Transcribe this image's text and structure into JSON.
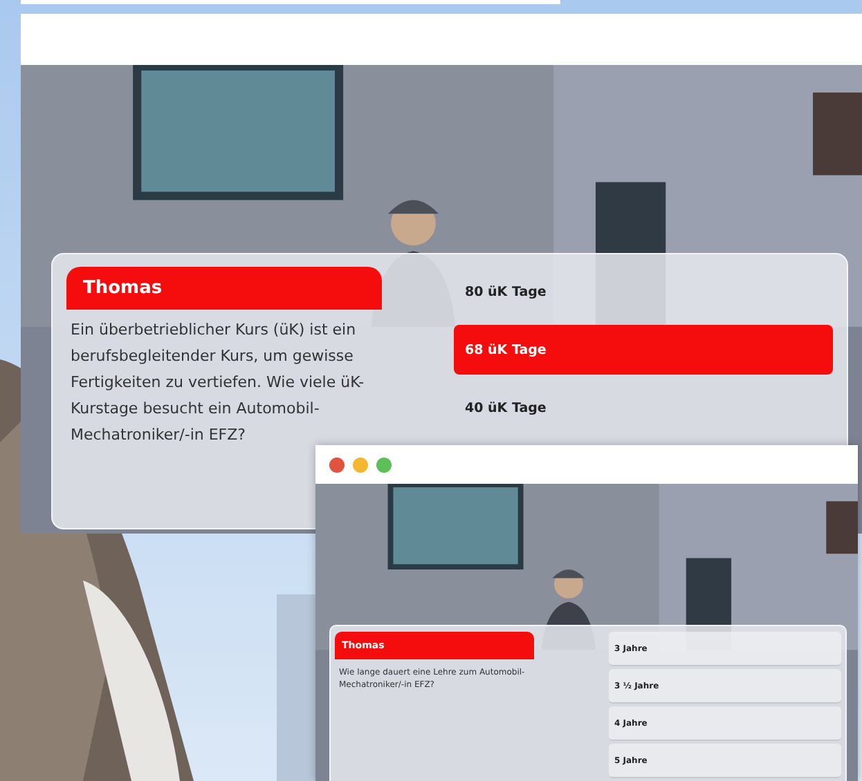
{
  "windows": [
    {
      "kind": "large",
      "dialog": {
        "speaker": "Thomas",
        "question": "Ein überbetrieblicher Kurs (üK) ist ein berufsbegleitender Kurs, um gewisse Fertigkeiten zu vertiefen. Wie viele üK-Kurstage besucht ein Automobil-Mechatroniker/-in EFZ?",
        "answers": [
          {
            "label": "80 üK Tage",
            "selected": false
          },
          {
            "label": "68 üK Tage",
            "selected": true
          },
          {
            "label": "40 üK Tage",
            "selected": false
          }
        ]
      }
    },
    {
      "kind": "small",
      "window_buttons": true,
      "dialog": {
        "speaker": "Thomas",
        "question": "Wie lange dauert eine Lehre zum Automobil-Mechatroniker/-in EFZ?",
        "answers": [
          {
            "label": "3 Jahre",
            "selected": false
          },
          {
            "label": "3 ½ Jahre",
            "selected": false
          },
          {
            "label": "4 Jahre",
            "selected": false
          },
          {
            "label": "5 Jahre",
            "selected": false
          }
        ]
      }
    }
  ]
}
